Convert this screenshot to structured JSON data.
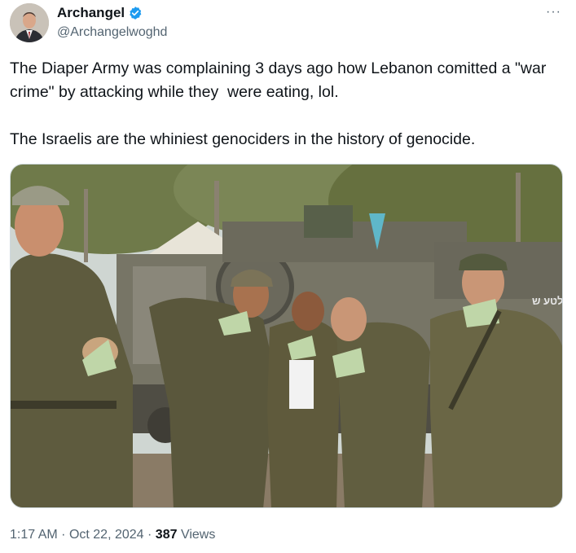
{
  "author": {
    "display_name": "Archangel",
    "handle": "@Archangelwoghd",
    "verified": true,
    "avatar_icon": "person-portrait-avatar"
  },
  "menu": {
    "more_label": "···"
  },
  "tweet": {
    "paragraphs": [
      "The Diaper Army was complaining 3 days ago how Lebanon comitted a \"war crime\" by attacking while they  were eating, lol.",
      "The Israelis are the whiniest genociders in the history of genocide."
    ]
  },
  "media": {
    "vehicle_marking": "לטע ש",
    "palette": {
      "uniform": "#5e5b3e",
      "sky": "#cfd6d2",
      "foliage": "#6f7a4a",
      "ground": "#8a7b66",
      "wrap": "#bfd6a8"
    }
  },
  "meta": {
    "time": "1:17 AM",
    "separator": "·",
    "date": "Oct 22, 2024",
    "views_count": "387",
    "views_label": "Views"
  },
  "colors": {
    "text": "#0f1419",
    "secondary": "#536471",
    "verified": "#1d9bf0"
  }
}
